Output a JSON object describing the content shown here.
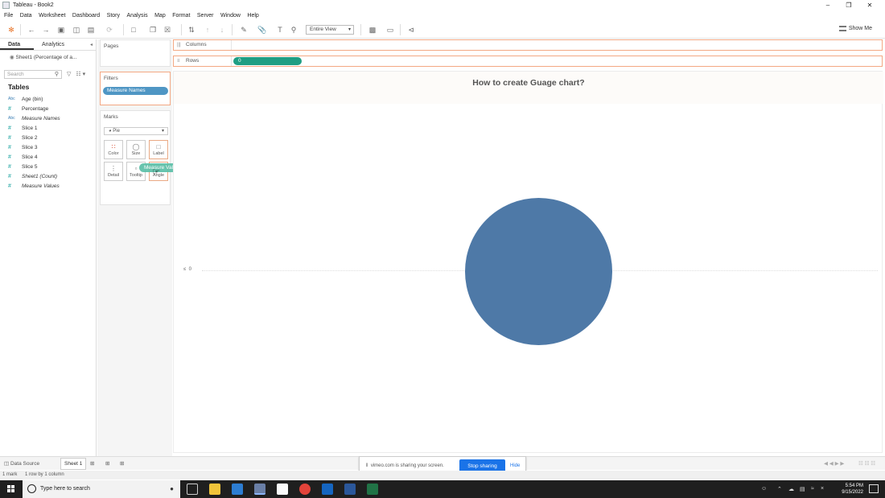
{
  "window": {
    "title": "Tableau - Book2"
  },
  "menu": [
    "File",
    "Data",
    "Worksheet",
    "Dashboard",
    "Story",
    "Analysis",
    "Map",
    "Format",
    "Server",
    "Window",
    "Help"
  ],
  "toolbar": {
    "fit_label": "Entire View",
    "show_me_label": "Show Me"
  },
  "datapane": {
    "tabs": [
      "Data",
      "Analytics"
    ],
    "datasource": "Sheet1 (Percentage of a...",
    "search_placeholder": "Search",
    "tables_heading": "Tables",
    "fields": [
      {
        "type": "Abc",
        "name": "Age (bin)",
        "italic": false
      },
      {
        "type": "#",
        "name": "Percentage",
        "italic": false
      },
      {
        "type": "Abc",
        "name": "Measure Names",
        "italic": true
      },
      {
        "type": "#",
        "name": "Slice 1",
        "italic": false
      },
      {
        "type": "#",
        "name": "Slice 2",
        "italic": false
      },
      {
        "type": "#",
        "name": "Slice 3",
        "italic": false
      },
      {
        "type": "#",
        "name": "Slice 4",
        "italic": false
      },
      {
        "type": "#",
        "name": "Slice 5",
        "italic": false
      },
      {
        "type": "#",
        "name": "Sheet1 (Count)",
        "italic": true
      },
      {
        "type": "#",
        "name": "Measure Values",
        "italic": true
      }
    ]
  },
  "cards": {
    "pages_title": "Pages",
    "filters_title": "Filters",
    "filter_pill": "Measure Names",
    "marks_title": "Marks",
    "mark_type": "Pie",
    "buttons": [
      "Color",
      "Size",
      "Label",
      "Detail",
      "Tooltip",
      "Angle"
    ]
  },
  "drag_pill": "Measure Values",
  "shelves": {
    "columns_label": "Columns",
    "rows_label": "Rows",
    "rows_pill": "0"
  },
  "view": {
    "title": "How to create Guage chart?",
    "axis_value": "0",
    "pie_color": "#4e79a7"
  },
  "sheetbar": {
    "datasource_tab": "Data Source",
    "sheet_tab": "Sheet 1"
  },
  "share_bar": {
    "message": "vimeo.com is sharing your screen.",
    "stop_label": "Stop sharing",
    "hide_label": "Hide"
  },
  "status": {
    "marks": "1 mark",
    "dims": "1 row by 1 column"
  },
  "taskbar": {
    "search_placeholder": "Type here to search",
    "time": "5:54 PM",
    "date": "9/15/2022"
  }
}
